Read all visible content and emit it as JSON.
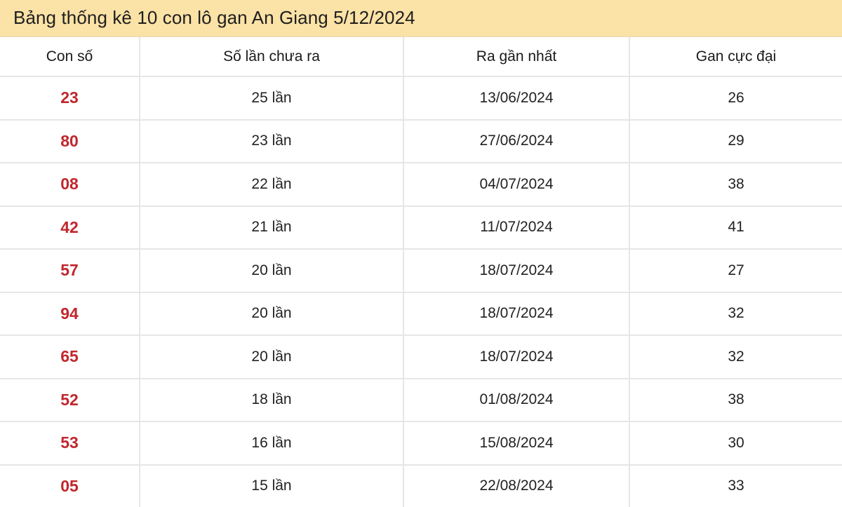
{
  "title": "Bảng thống kê 10 con lô gan An Giang 5/12/2024",
  "colors": {
    "header_bg": "#fbe2a6",
    "number_red": "#c0272d"
  },
  "table": {
    "headers": [
      "Con số",
      "Số lần chưa ra",
      "Ra gần nhất",
      "Gan cực đại"
    ],
    "rows": [
      {
        "num": "23",
        "count": "25 lần",
        "last": "13/06/2024",
        "max": "26"
      },
      {
        "num": "80",
        "count": "23 lần",
        "last": "27/06/2024",
        "max": "29"
      },
      {
        "num": "08",
        "count": "22 lần",
        "last": "04/07/2024",
        "max": "38"
      },
      {
        "num": "42",
        "count": "21 lần",
        "last": "11/07/2024",
        "max": "41"
      },
      {
        "num": "57",
        "count": "20 lần",
        "last": "18/07/2024",
        "max": "27"
      },
      {
        "num": "94",
        "count": "20 lần",
        "last": "18/07/2024",
        "max": "32"
      },
      {
        "num": "65",
        "count": "20 lần",
        "last": "18/07/2024",
        "max": "32"
      },
      {
        "num": "52",
        "count": "18 lần",
        "last": "01/08/2024",
        "max": "38"
      },
      {
        "num": "53",
        "count": "16 lần",
        "last": "15/08/2024",
        "max": "30"
      },
      {
        "num": "05",
        "count": "15 lần",
        "last": "22/08/2024",
        "max": "33"
      }
    ]
  }
}
